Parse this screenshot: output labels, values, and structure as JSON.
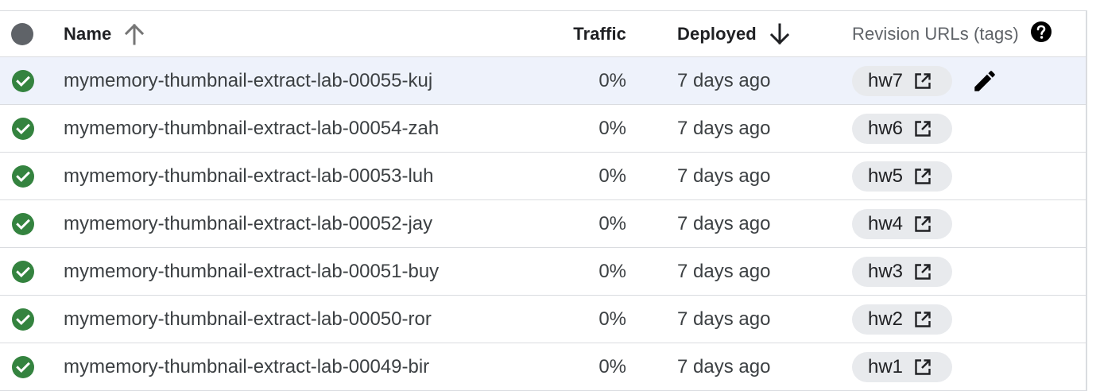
{
  "colors": {
    "success": "#34833f",
    "selected_row_bg": "#eef2fb",
    "chip_bg": "#e8eaed",
    "border": "#dadce0"
  },
  "table": {
    "columns": {
      "select_all_icon": "circle-checkbox-icon",
      "name": "Name",
      "name_sort_icon": "arrow-up-icon",
      "traffic": "Traffic",
      "deployed": "Deployed",
      "deployed_sort_icon": "arrow-down-icon",
      "revision_urls": "Revision URLs (tags)",
      "help_icon": "help-circle-icon"
    },
    "rows": [
      {
        "status_icon": "check-circle-icon",
        "name": "mymemory-thumbnail-extract-lab-00055-kuj",
        "traffic": "0%",
        "deployed": "7 days ago",
        "tag": "hw7",
        "tag_icon": "open-in-new-icon",
        "selected": true,
        "edit_icon": "pencil-icon"
      },
      {
        "status_icon": "check-circle-icon",
        "name": "mymemory-thumbnail-extract-lab-00054-zah",
        "traffic": "0%",
        "deployed": "7 days ago",
        "tag": "hw6",
        "tag_icon": "open-in-new-icon",
        "selected": false
      },
      {
        "status_icon": "check-circle-icon",
        "name": "mymemory-thumbnail-extract-lab-00053-luh",
        "traffic": "0%",
        "deployed": "7 days ago",
        "tag": "hw5",
        "tag_icon": "open-in-new-icon",
        "selected": false
      },
      {
        "status_icon": "check-circle-icon",
        "name": "mymemory-thumbnail-extract-lab-00052-jay",
        "traffic": "0%",
        "deployed": "7 days ago",
        "tag": "hw4",
        "tag_icon": "open-in-new-icon",
        "selected": false
      },
      {
        "status_icon": "check-circle-icon",
        "name": "mymemory-thumbnail-extract-lab-00051-buy",
        "traffic": "0%",
        "deployed": "7 days ago",
        "tag": "hw3",
        "tag_icon": "open-in-new-icon",
        "selected": false
      },
      {
        "status_icon": "check-circle-icon",
        "name": "mymemory-thumbnail-extract-lab-00050-ror",
        "traffic": "0%",
        "deployed": "7 days ago",
        "tag": "hw2",
        "tag_icon": "open-in-new-icon",
        "selected": false
      },
      {
        "status_icon": "check-circle-icon",
        "name": "mymemory-thumbnail-extract-lab-00049-bir",
        "traffic": "0%",
        "deployed": "7 days ago",
        "tag": "hw1",
        "tag_icon": "open-in-new-icon",
        "selected": false
      }
    ]
  }
}
